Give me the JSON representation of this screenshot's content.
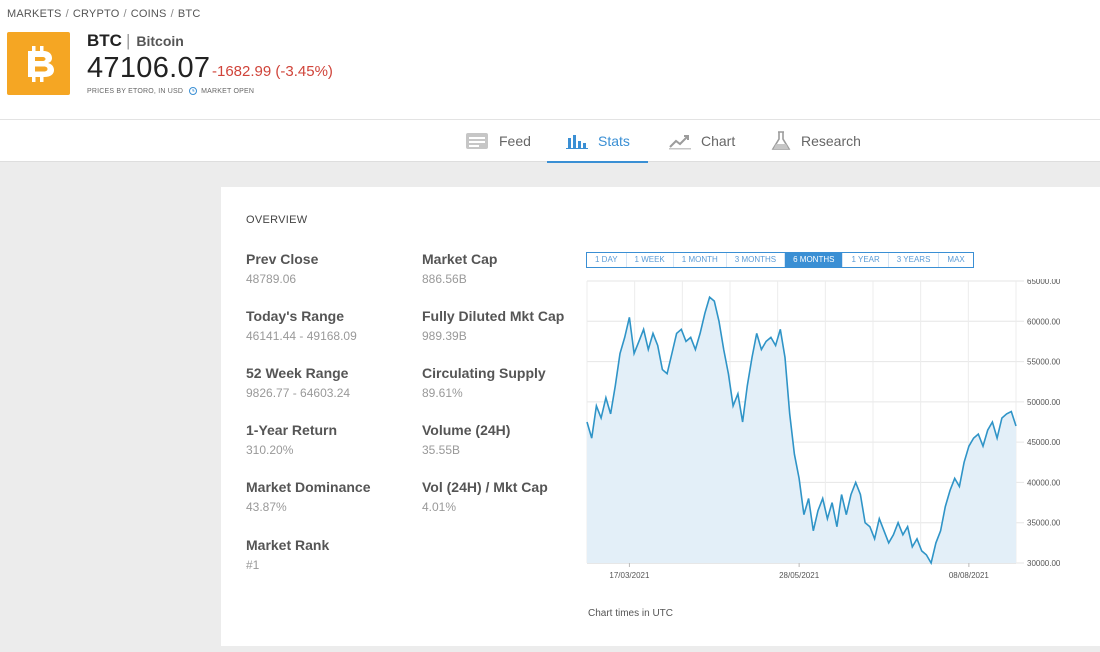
{
  "breadcrumb": [
    "MARKETS",
    "CRYPTO",
    "COINS",
    "BTC"
  ],
  "asset": {
    "logo_icon": "bitcoin-icon",
    "logo_color": "#f5a623",
    "symbol": "BTC",
    "separator": "|",
    "name": "Bitcoin",
    "price": "47106.07",
    "change": "-1682.99 (-3.45%)",
    "change_color": "#d0443a",
    "source_note": "PRICES BY ETORO, IN USD",
    "market_status": "MARKET OPEN"
  },
  "tabs": [
    {
      "label": "Feed",
      "icon": "feed-icon",
      "active": false
    },
    {
      "label": "Stats",
      "icon": "bar-chart-icon",
      "active": true
    },
    {
      "label": "Chart",
      "icon": "line-chart-icon",
      "active": false
    },
    {
      "label": "Research",
      "icon": "flask-icon",
      "active": false
    }
  ],
  "accent_color": "#3a8fd4",
  "overview": {
    "heading": "OVERVIEW",
    "stats": [
      {
        "label": "Prev Close",
        "value": "48789.06"
      },
      {
        "label": "Today's Range",
        "value": "46141.44 - 49168.09"
      },
      {
        "label": "52 Week Range",
        "value": "9826.77 - 64603.24"
      },
      {
        "label": "1-Year Return",
        "value": "310.20%"
      },
      {
        "label": "Market Dominance",
        "value": "43.87%"
      },
      {
        "label": "Market Rank",
        "value": "#1"
      },
      {
        "label": "Market Cap",
        "value": "886.56B"
      },
      {
        "label": "Fully Diluted Mkt Cap",
        "value": "989.39B"
      },
      {
        "label": "Circulating Supply",
        "value": "89.61%"
      },
      {
        "label": "Volume (24H)",
        "value": "35.55B"
      },
      {
        "label": "Vol (24H) / Mkt Cap",
        "value": "4.01%"
      }
    ]
  },
  "ranges": [
    {
      "label": "1 DAY",
      "active": false
    },
    {
      "label": "1 WEEK",
      "active": false
    },
    {
      "label": "1 MONTH",
      "active": false
    },
    {
      "label": "3 MONTHS",
      "active": false
    },
    {
      "label": "6 MONTHS",
      "active": true
    },
    {
      "label": "1 YEAR",
      "active": false
    },
    {
      "label": "3 YEARS",
      "active": false
    },
    {
      "label": "MAX",
      "active": false
    }
  ],
  "chart_note": "Chart times in UTC",
  "chart_data": {
    "type": "area",
    "title": "",
    "xlabel": "",
    "ylabel": "",
    "ylim": [
      30000,
      65000
    ],
    "y_ticks": [
      "65000.00",
      "60000.00",
      "55000.00",
      "50000.00",
      "45000.00",
      "40000.00",
      "35000.00",
      "30000.00"
    ],
    "x_ticks": [
      {
        "label": "17/03/2021",
        "index": 9
      },
      {
        "label": "28/05/2021",
        "index": 45
      },
      {
        "label": "08/08/2021",
        "index": 81
      }
    ],
    "grid": true,
    "line_color": "#2f94c7",
    "fill_color": "#e3eff8",
    "series": [
      {
        "values": [
          47500,
          45500,
          49500,
          48000,
          50500,
          48500,
          52000,
          56000,
          58000,
          60500,
          56000,
          57500,
          59000,
          56500,
          58500,
          57000,
          54000,
          53500,
          56000,
          58500,
          59000,
          57500,
          58000,
          56500,
          58500,
          61000,
          63000,
          62500,
          60000,
          56500,
          53500,
          49500,
          51000,
          47500,
          52000,
          55500,
          58500,
          56500,
          57500,
          58000,
          57000,
          59000,
          55500,
          48500,
          43500,
          40500,
          36000,
          38000,
          34000,
          36500,
          38000,
          35500,
          37500,
          34500,
          38500,
          36000,
          38500,
          40000,
          38500,
          35000,
          34500,
          33000,
          35500,
          34000,
          32500,
          33500,
          35000,
          33500,
          34500,
          32000,
          33000,
          31500,
          31000,
          30000,
          32500,
          34000,
          37000,
          39000,
          40500,
          39500,
          42500,
          44500,
          45500,
          46000,
          44500,
          46500,
          47500,
          45500,
          48000,
          48500,
          48800,
          47000
        ]
      }
    ]
  }
}
